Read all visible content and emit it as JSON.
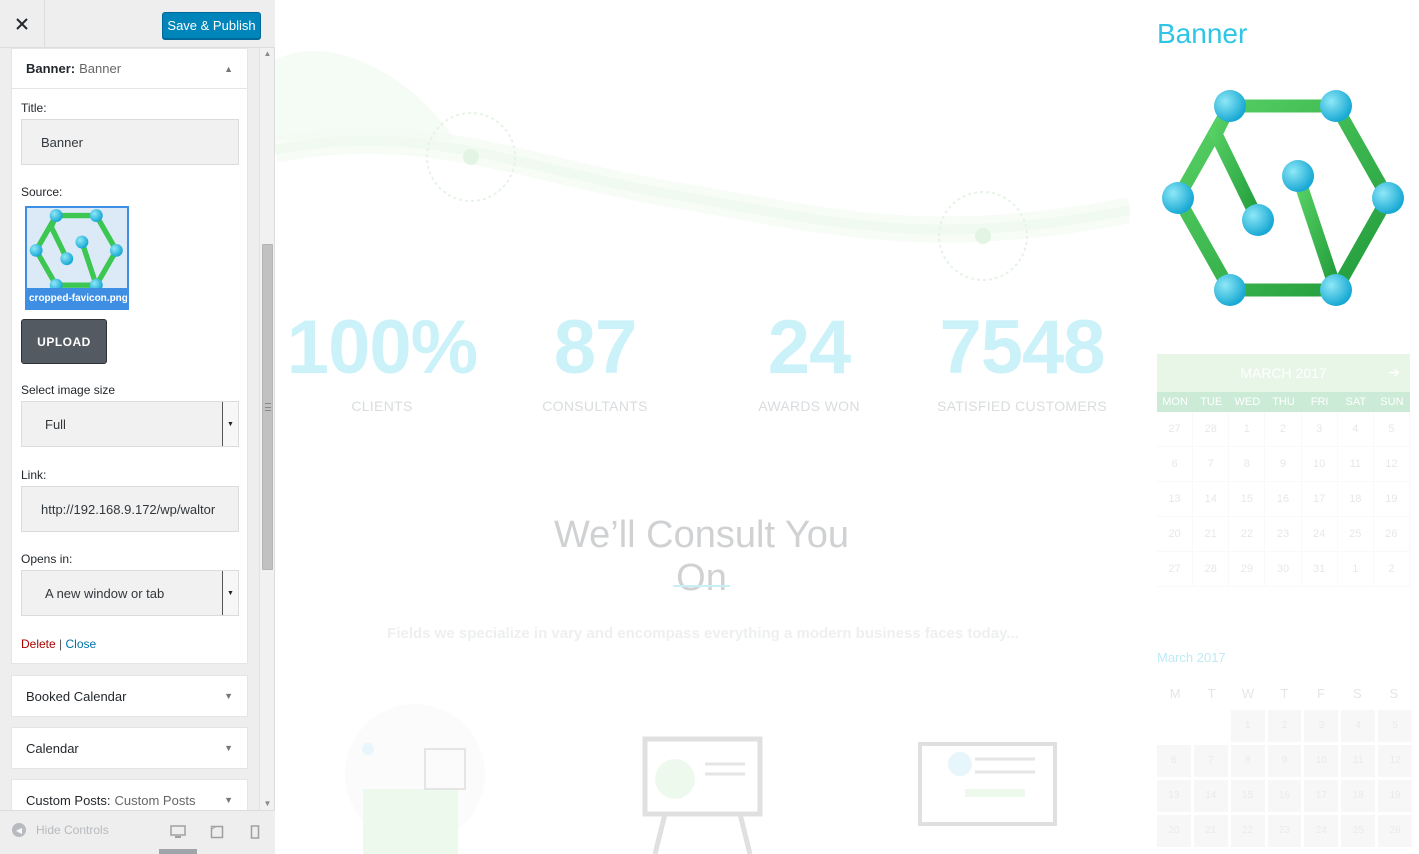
{
  "toolbar": {
    "close_icon": "close-icon",
    "save_label": "Save & Publish"
  },
  "banner_widget": {
    "heading_bold": "Banner:",
    "heading_name": "Banner",
    "title_label": "Title:",
    "title_value": "Banner",
    "source_label": "Source:",
    "source_filename": "cropped-favicon.png",
    "upload_label": "UPLOAD",
    "image_size_label": "Select image size",
    "image_size_value": "Full",
    "link_label": "Link:",
    "link_value": "http://192.168.9.172/wp/waltor",
    "opens_in_label": "Opens in:",
    "opens_in_value": "A new window or tab",
    "delete_label": "Delete",
    "separator": "|",
    "close_label": "Close"
  },
  "collapsed_widgets": [
    {
      "bold": "Booked Calendar",
      "sub": ""
    },
    {
      "bold": "Calendar",
      "sub": ""
    },
    {
      "bold": "Custom Posts:",
      "sub": "Custom Posts"
    }
  ],
  "footer": {
    "hide_controls_label": "Hide Controls",
    "devices": [
      "desktop-icon",
      "tablet-icon",
      "mobile-icon"
    ]
  },
  "preview": {
    "stats": [
      {
        "value": "100%",
        "label": "CLIENTS"
      },
      {
        "value": "87",
        "label": "CONSULTANTS"
      },
      {
        "value": "24",
        "label": "AWARDS WON"
      },
      {
        "value": "7548",
        "label": "SATISFIED CUSTOMERS"
      }
    ],
    "section_title": "We’ll Consult You On",
    "section_subtitle": "Fields we specialize in vary and encompass everything a modern business faces today...",
    "sidebar_widget_title": "Banner",
    "calendar1": {
      "month": "MARCH 2017",
      "days": [
        "MON",
        "TUE",
        "WED",
        "THU",
        "FRI",
        "SAT",
        "SUN"
      ],
      "dates": [
        "27",
        "28",
        "1",
        "2",
        "3",
        "4",
        "5",
        "6",
        "7",
        "8",
        "9",
        "10",
        "11",
        "12",
        "13",
        "14",
        "15",
        "16",
        "17",
        "18",
        "19",
        "20",
        "21",
        "22",
        "23",
        "24",
        "25",
        "26",
        "27",
        "28",
        "29",
        "30",
        "31",
        "1",
        "2"
      ]
    },
    "calendar2": {
      "month": "March 2017",
      "days": [
        "M",
        "T",
        "W",
        "T",
        "F",
        "S",
        "S"
      ],
      "dates": [
        "",
        "",
        "1",
        "2",
        "3",
        "4",
        "5",
        "6",
        "7",
        "8",
        "9",
        "10",
        "11",
        "12",
        "13",
        "14",
        "15",
        "16",
        "17",
        "18",
        "19",
        "20",
        "21",
        "22",
        "23",
        "24",
        "25",
        "26"
      ]
    }
  },
  "colors": {
    "primary_button": "#0085ba",
    "accent_cyan": "#2ec5e6",
    "logo_green": "#3cc652",
    "delete_red": "#aa0000",
    "link_blue": "#0073aa"
  }
}
